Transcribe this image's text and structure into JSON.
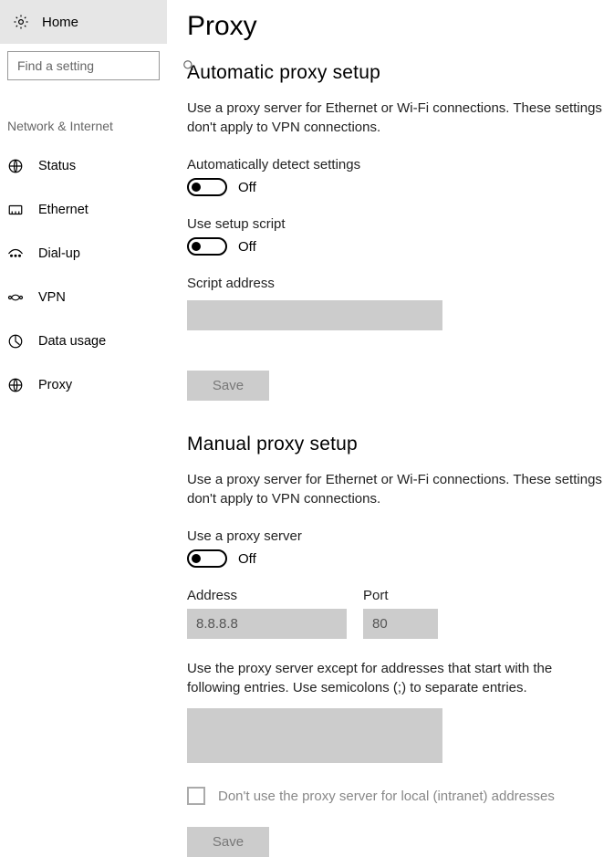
{
  "sidebar": {
    "home_label": "Home",
    "search_placeholder": "Find a setting",
    "category_label": "Network & Internet",
    "items": [
      {
        "icon": "status-icon",
        "label": "Status"
      },
      {
        "icon": "ethernet-icon",
        "label": "Ethernet"
      },
      {
        "icon": "dialup-icon",
        "label": "Dial-up"
      },
      {
        "icon": "vpn-icon",
        "label": "VPN"
      },
      {
        "icon": "datausage-icon",
        "label": "Data usage"
      },
      {
        "icon": "proxy-icon",
        "label": "Proxy"
      }
    ]
  },
  "page": {
    "title": "Proxy",
    "section_auto": {
      "title": "Automatic proxy setup",
      "desc": "Use a proxy server for Ethernet or Wi-Fi connections. These settings don't apply to VPN connections.",
      "auto_detect_label": "Automatically detect settings",
      "auto_detect_state": "Off",
      "use_script_label": "Use setup script",
      "use_script_state": "Off",
      "script_address_label": "Script address",
      "script_address_value": "",
      "save_label": "Save"
    },
    "section_manual": {
      "title": "Manual proxy setup",
      "desc": "Use a proxy server for Ethernet or Wi-Fi connections. These settings don't apply to VPN connections.",
      "use_proxy_label": "Use a proxy server",
      "use_proxy_state": "Off",
      "address_label": "Address",
      "address_placeholder": "8.8.8.8",
      "port_label": "Port",
      "port_placeholder": "80",
      "exceptions_desc": "Use the proxy server except for addresses that start with the following entries. Use semicolons (;) to separate entries.",
      "exceptions_value": "",
      "bypass_local_label": "Don't use the proxy server for local (intranet) addresses",
      "save_label": "Save"
    }
  }
}
